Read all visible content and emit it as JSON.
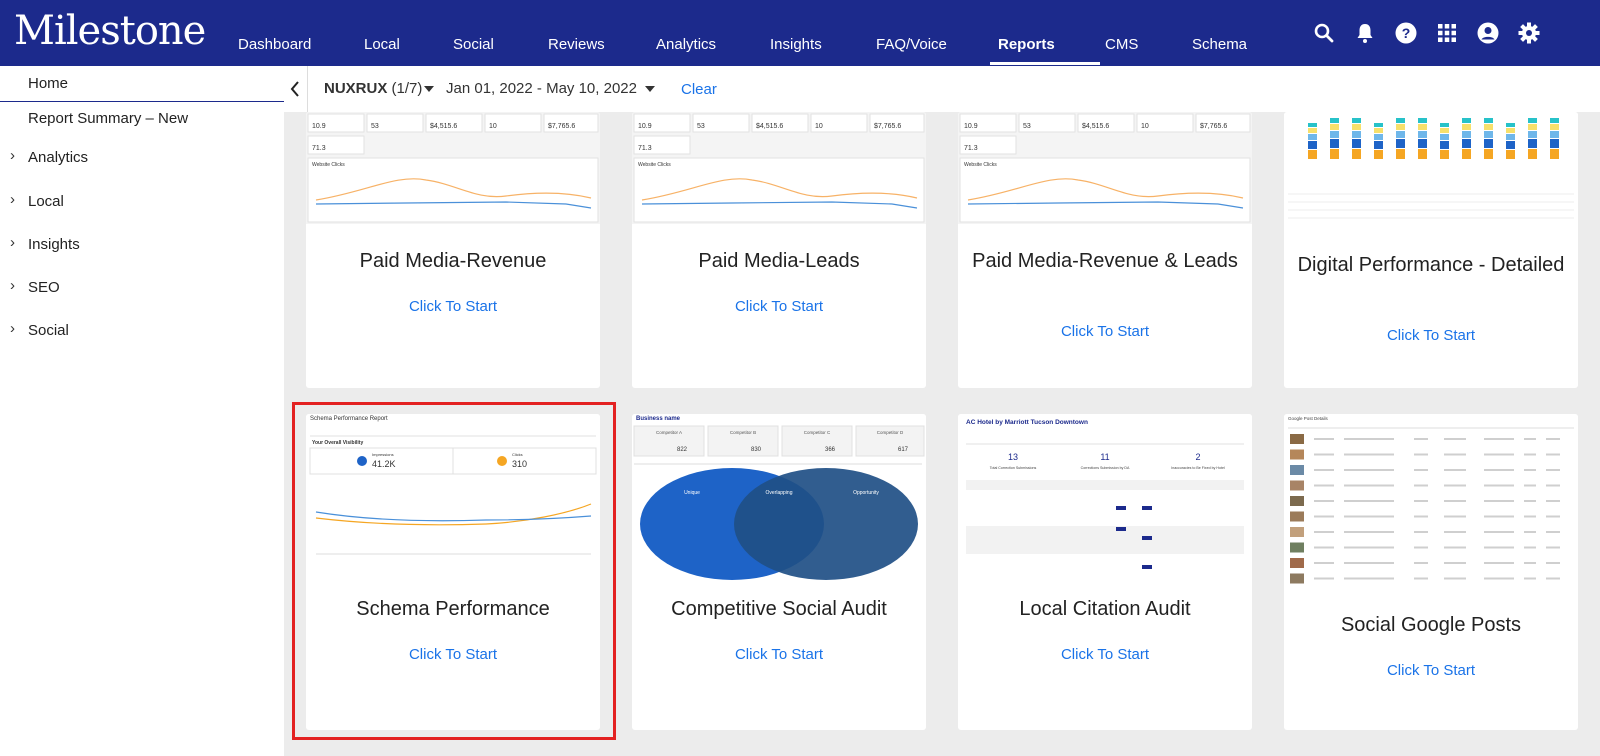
{
  "app": {
    "logo_text": "Milestone"
  },
  "nav": {
    "items": [
      {
        "label": "Dashboard"
      },
      {
        "label": "Local"
      },
      {
        "label": "Social"
      },
      {
        "label": "Reviews"
      },
      {
        "label": "Analytics"
      },
      {
        "label": "Insights"
      },
      {
        "label": "FAQ/Voice"
      },
      {
        "label": "Reports",
        "active": true
      },
      {
        "label": "CMS"
      },
      {
        "label": "Schema"
      }
    ],
    "icons": [
      "search-icon",
      "bell-icon",
      "help-icon",
      "apps-grid-icon",
      "account-icon",
      "settings-icon"
    ]
  },
  "sidebar": {
    "home": "Home",
    "report_summary": "Report Summary – New",
    "groups": [
      {
        "label": "Analytics"
      },
      {
        "label": "Local"
      },
      {
        "label": "Insights"
      },
      {
        "label": "SEO"
      },
      {
        "label": "Social"
      }
    ]
  },
  "filters": {
    "account": "NUXRUX",
    "account_count": "(1/7)",
    "date_range": "Jan 01, 2022 - May 10, 2022",
    "clear": "Clear"
  },
  "cards": [
    {
      "title": "Paid Media-Revenue",
      "cta": "Click To Start"
    },
    {
      "title": "Paid Media-Leads",
      "cta": "Click To Start"
    },
    {
      "title": "Paid Media-Revenue & Leads",
      "cta": "Click To Start"
    },
    {
      "title": "Digital Performance - Detailed",
      "cta": "Click To Start"
    },
    {
      "title": "Schema Performance",
      "cta": "Click To Start",
      "selected": true
    },
    {
      "title": "Competitive Social Audit",
      "cta": "Click To Start"
    },
    {
      "title": "Local Citation Audit",
      "cta": "Click To Start"
    },
    {
      "title": "Social Google Posts",
      "cta": "Click To Start"
    }
  ],
  "thumbnails": {
    "paid_media_metrics": [
      "10.9",
      "53",
      "$4,515.6",
      "10",
      "$7,765.6",
      "71.3"
    ],
    "paid_media_chart_label": "Website Clicks",
    "schema": {
      "report_title": "Schema Performance Report",
      "visibility_label": "Your Overall Visibility",
      "impressions_label": "Impressions",
      "impressions_value": "41.2K",
      "clicks_label": "Clicks",
      "clicks_value": "310"
    },
    "competitive": {
      "business_label": "Business name",
      "competitors": [
        "Competitor A",
        "Competitor B",
        "Competitor C",
        "Competitor D"
      ],
      "competitor_values": [
        "822",
        "830",
        "366",
        "617"
      ],
      "unique_label": "Unique",
      "overlap_label": "Overlapping",
      "opportunity_label": "Opportunity"
    },
    "citation": {
      "hotel_name": "AC Hotel by Marriott Tucson Downtown",
      "stats": [
        "13",
        "11",
        "2"
      ],
      "stat_labels": [
        "Total Correction Submissions",
        "Corrections Submission by DA",
        "Inaccuracies to Be Fixed by Hotel"
      ]
    },
    "posts_label": "Google Post Details"
  },
  "colors": {
    "brand_nav": "#1c2a8c",
    "link_blue": "#1a73e8",
    "highlight_red": "#e32222",
    "venn_left": "#1e63c7",
    "venn_right": "#1f4f86"
  }
}
